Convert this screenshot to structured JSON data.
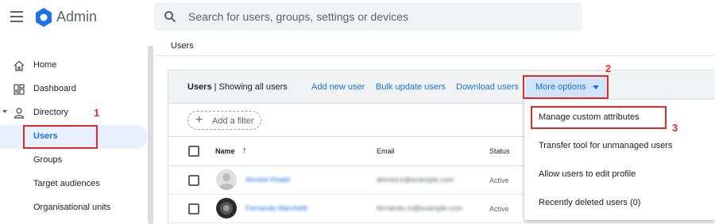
{
  "header": {
    "app_title": "Admin",
    "search_placeholder": "Search for users, groups, settings or devices",
    "logo_color": "#1a73e8"
  },
  "sidebar": {
    "items": [
      {
        "label": "Home",
        "icon": "home-icon"
      },
      {
        "label": "Dashboard",
        "icon": "dashboard-icon"
      },
      {
        "label": "Directory",
        "icon": "person-icon",
        "expanded": true
      },
      {
        "label": "Users",
        "active": true
      },
      {
        "label": "Groups"
      },
      {
        "label": "Target audiences"
      },
      {
        "label": "Organisational units"
      }
    ]
  },
  "main": {
    "breadcrumb": "Users",
    "toolbar": {
      "title_bold": "Users",
      "title_rest": " | Showing all users",
      "add_new_user": "Add new user",
      "bulk_update": "Bulk update users",
      "download": "Download users",
      "more_options": "More options"
    },
    "filter": {
      "label": "Add a filter"
    },
    "table": {
      "columns": [
        "Name",
        "Email",
        "Status"
      ],
      "rows": [
        {
          "name": "Ahmed Khalid",
          "email": "ahmed.k@example.com",
          "status": "Active",
          "avatar": "placeholder"
        },
        {
          "name": "Fernando Marchetti",
          "email": "fernando.m@example.com",
          "status": "Active",
          "avatar": "photo"
        }
      ]
    }
  },
  "menu": {
    "items": [
      "Manage custom attributes",
      "Transfer tool for unmanaged users",
      "Allow users to edit profile",
      "Recently deleted users (0)"
    ]
  },
  "annotations": [
    "1",
    "2",
    "3"
  ],
  "colors": {
    "accent": "#1a73e8",
    "annotation": "#e02b2b",
    "toolbar_bg": "#f1f3f4",
    "active_bg": "#e8f0fe"
  }
}
